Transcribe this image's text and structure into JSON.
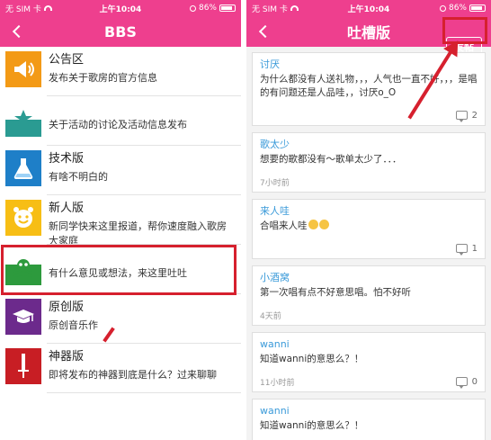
{
  "status_bar": {
    "carrier": "无 SIM 卡",
    "time": "上午10:04",
    "battery": "86%"
  },
  "left": {
    "title": "BBS",
    "boards": [
      {
        "title": "公告区",
        "desc": "发布关于歌房的官方信息",
        "icon": "megaphone-icon",
        "color": "#f39a16"
      },
      {
        "title": "",
        "desc": "关于活动的讨论及活动信息发布",
        "icon": "star-icon",
        "color": "#2a9b92"
      },
      {
        "title": "技术版",
        "desc": "有啥不明白的",
        "icon": "flask-icon",
        "color": "#1e7fc8"
      },
      {
        "title": "新人版",
        "desc": "新同学快来这里报道，帮你速度融入歌房大家庭",
        "icon": "smile-icon",
        "color": "#f7be15"
      },
      {
        "title": "",
        "desc": "有什么意见或想法，来这里吐吐",
        "icon": "skull-icon",
        "color": "#2d9a3d"
      },
      {
        "title": "原创版",
        "desc": "原创音乐作",
        "icon": "mortarboard-icon",
        "color": "#6c2a8c"
      },
      {
        "title": "神器版",
        "desc": "即将发布的神器到底是什么？过来聊聊",
        "icon": "sword-icon",
        "color": "#c81e24"
      }
    ]
  },
  "right": {
    "title": "吐槽版",
    "post_button": "发帖",
    "posts": [
      {
        "author": "讨厌",
        "content": "为什么都没有人送礼物，，，人气也一直不好，，，是唱的有问题还是人品哇，，讨厌o_O",
        "time": "",
        "comments": "2"
      },
      {
        "author": "歌太少",
        "content": "想要的歌都没有～歌单太少了．．．",
        "time": "7小时前",
        "comments": ""
      },
      {
        "author": "来人哇",
        "content": "合唱来人哇",
        "time": "",
        "comments": "1"
      },
      {
        "author": "小酒窝",
        "content": "第一次唱有点不好意思唱。怕不好听",
        "time": "4天前",
        "comments": ""
      },
      {
        "author": "wanni",
        "content": "知道wanni的意思么？！",
        "time": "11小时前",
        "comments": "0"
      },
      {
        "author": "wanni",
        "content": "知道wanni的意思么？！",
        "time": "",
        "comments": ""
      }
    ]
  },
  "colors": {
    "brand": "#ee3f8e",
    "annotation": "#d6202e",
    "link": "#3a9ad9"
  }
}
